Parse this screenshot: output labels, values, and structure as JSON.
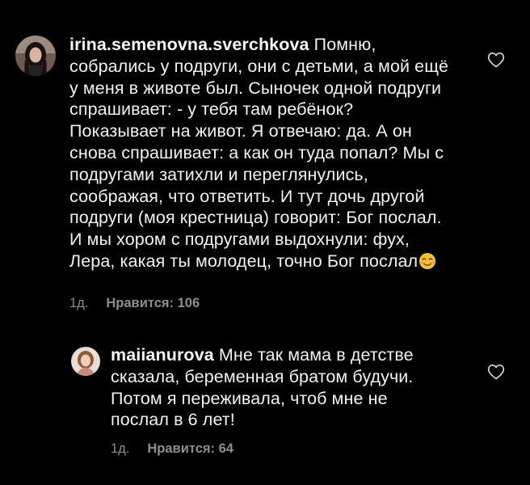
{
  "comments": [
    {
      "username": "irina.semenovna.sverchkova",
      "text": "Помню, собрались у подруги, они с детьми, а мой ещё у меня в животе был. Сыночек одной подруги спрашивает: - у тебя там ребёнок? Показывает на живот. Я отвечаю: да. А он снова спрашивает: а как он туда попал? Мы с подругами затихли и переглянулись, соображая, что ответить. И тут дочь другой подруги (моя крестница) говорит: Бог послал. И мы хором с подругами выдохнули: фух, Лера, какая ты молодец, точно Бог послал",
      "emoji": "smiling-face-with-blush-emoji",
      "time": "1д.",
      "likes": "Нравится: 106",
      "avatar_icon": "user-avatar-woman-dark-hair"
    },
    {
      "username": "maiianurova",
      "text": "Мне так мама в детстве сказала, беременная братом будучи. Потом я переживала, чтоб мне не послал в 6 лет!",
      "time": "1д.",
      "likes": "Нравится: 64",
      "avatar_icon": "user-avatar-woman-light"
    }
  ],
  "icons": {
    "like": "heart-outline-icon"
  },
  "colors": {
    "background": "#000000",
    "text": "#f2f2f2",
    "meta": "#8e8e8e",
    "emoji": "#f7c232"
  }
}
